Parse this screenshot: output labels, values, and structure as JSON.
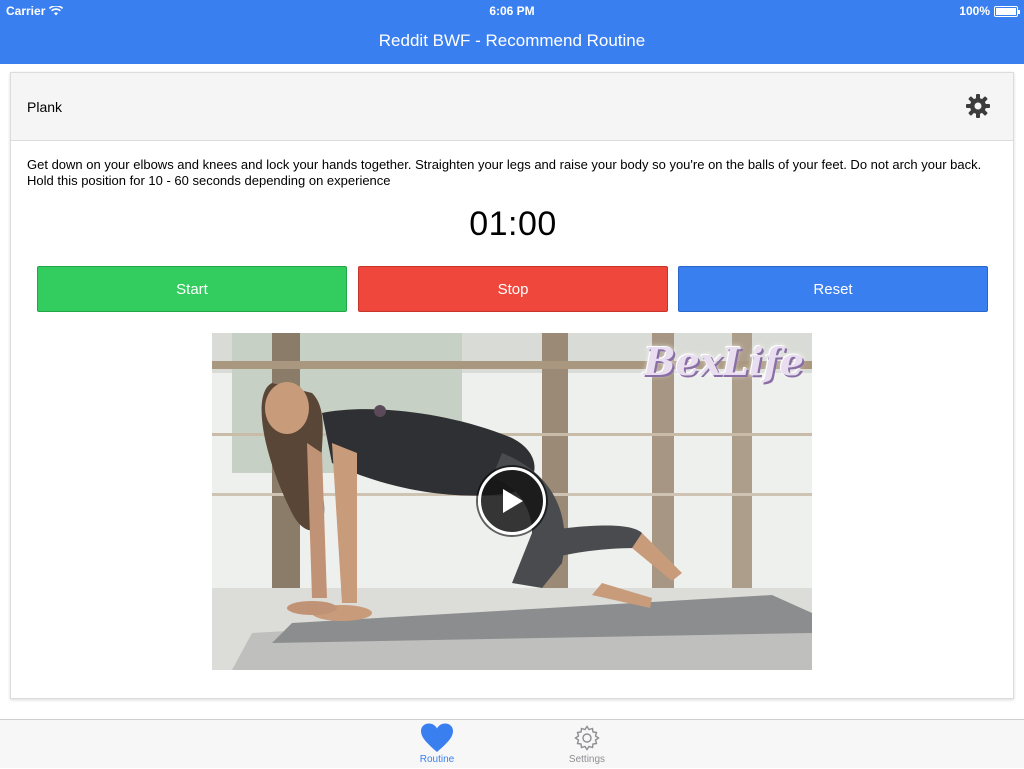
{
  "status_bar": {
    "carrier": "Carrier",
    "time": "6:06 PM",
    "battery": "100%"
  },
  "nav": {
    "title": "Reddit BWF - Recommend Routine"
  },
  "exercise": {
    "name": "Plank",
    "description": "Get down on your elbows and knees and lock your hands together. Straighten your legs and raise your body so you're on the balls of your feet. Do not arch your back. Hold this position for 10 - 60 seconds depending on experience",
    "timer": "01:00"
  },
  "controls": {
    "start_label": "Start",
    "stop_label": "Stop",
    "reset_label": "Reset"
  },
  "video": {
    "watermark": "BexLife"
  },
  "tabs": [
    {
      "label": "Routine",
      "icon": "heart-icon",
      "selected": true
    },
    {
      "label": "Settings",
      "icon": "gear-icon",
      "selected": false
    }
  ],
  "colors": {
    "accent": "#3a7ff0",
    "start": "#33cc5f",
    "stop": "#f0473c",
    "reset": "#3a7ff0"
  }
}
